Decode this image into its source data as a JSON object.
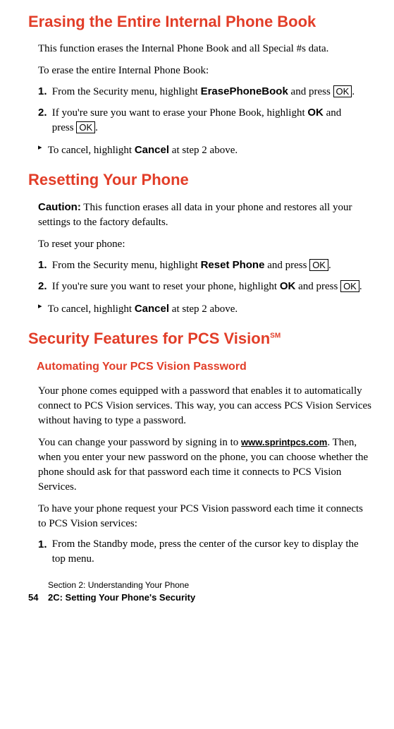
{
  "sections": {
    "erase": {
      "title": "Erasing the Entire Internal Phone Book",
      "intro": "This function erases the Internal Phone Book and all Special #s data.",
      "howto": "To erase the entire Internal Phone Book:",
      "step1_num": "1.",
      "step1_a": "From the Security menu, highlight ",
      "step1_b": "ErasePhoneBook",
      "step1_c": " and press ",
      "step1_key": "OK",
      "step1_d": ".",
      "step2_num": "2.",
      "step2_a": "If you're sure you want to erase your Phone Book, highlight ",
      "step2_b": "OK",
      "step2_c": " and press ",
      "step2_key": "OK",
      "step2_d": ".",
      "cancel_a": "To cancel, highlight ",
      "cancel_b": "Cancel",
      "cancel_c": " at step 2 above."
    },
    "reset": {
      "title": "Resetting Your Phone",
      "caution_label": "Caution:",
      "caution_text": " This function erases all data in your phone and restores all your settings to the factory defaults.",
      "howto": "To reset your phone:",
      "step1_num": "1.",
      "step1_a": "From the Security menu, highlight ",
      "step1_b": "Reset Phone",
      "step1_c": " and press ",
      "step1_key": "OK",
      "step1_d": ".",
      "step2_num": "2.",
      "step2_a": "If you're sure you want to reset your phone, highlight ",
      "step2_b": "OK",
      "step2_c": " and press ",
      "step2_key": "OK",
      "step2_d": ".",
      "cancel_a": "To cancel, highlight ",
      "cancel_b": "Cancel",
      "cancel_c": " at step 2 above."
    },
    "vision": {
      "title_a": "Security Features for PCS Vision",
      "title_sm": "SM",
      "subhead": "Automating Your PCS Vision Password",
      "para1": "Your phone comes equipped with a password that enables it to automatically connect to PCS Vision services. This way, you can access PCS Vision Services without having to type a password.",
      "para2_a": "You can change your password by signing in to ",
      "para2_url": "www.sprintpcs.com",
      "para2_b": ". Then, when you enter your new password on the phone, you can choose whether the phone should ask for that password each time it connects to PCS Vision Services.",
      "para3": "To have your phone request your PCS Vision password each time it connects to PCS Vision services:",
      "step1_num": "1.",
      "step1_text": "From the Standby mode, press the center of the cursor key to display the top menu."
    }
  },
  "footer": {
    "line1": "Section 2: Understanding Your Phone",
    "page_num": "54",
    "line2": "2C: Setting Your Phone's Security"
  },
  "glyphs": {
    "triangle": "▸"
  }
}
